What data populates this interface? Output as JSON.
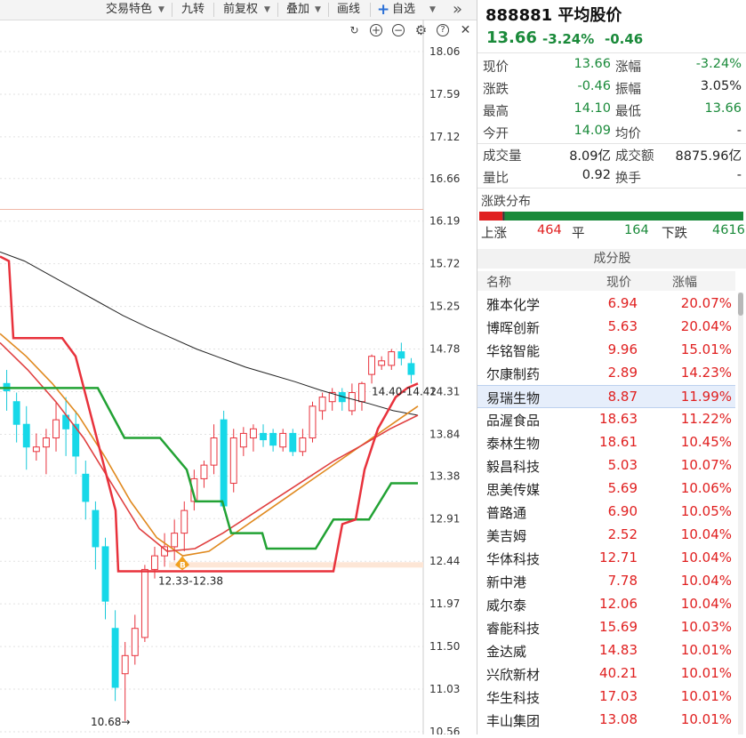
{
  "toolbar": {
    "items": [
      "交易特色",
      "九转",
      "前复权",
      "叠加",
      "画线",
      "自选"
    ],
    "more": "»"
  },
  "chart": {
    "price_axis": [
      "18.06",
      "17.59",
      "17.12",
      "16.66",
      "16.19",
      "15.72",
      "15.25",
      "14.78",
      "14.31",
      "13.84",
      "13.38",
      "12.91",
      "12.44",
      "11.97",
      "11.50",
      "11.03",
      "10.56"
    ],
    "annotation_low": "10.68→",
    "annotation_range": "12.33-12.38",
    "annotation_recent": "14.40-14.42",
    "buy_mark": "B"
  },
  "chart_data": {
    "type": "candlestick",
    "ylim": [
      10.56,
      18.06
    ],
    "candles": [
      {
        "o": 14.4,
        "c": 14.32,
        "h": 14.55,
        "l": 14.1
      },
      {
        "o": 14.2,
        "c": 13.95,
        "h": 14.3,
        "l": 13.75
      },
      {
        "o": 13.95,
        "c": 13.7,
        "h": 14.15,
        "l": 13.45
      },
      {
        "o": 13.65,
        "c": 13.7,
        "h": 13.85,
        "l": 13.55
      },
      {
        "o": 13.7,
        "c": 13.8,
        "h": 13.9,
        "l": 13.4
      },
      {
        "o": 13.8,
        "c": 14.0,
        "h": 14.2,
        "l": 13.65
      },
      {
        "o": 14.05,
        "c": 13.9,
        "h": 14.25,
        "l": 13.6
      },
      {
        "o": 13.95,
        "c": 13.6,
        "h": 14.1,
        "l": 13.4
      },
      {
        "o": 13.4,
        "c": 13.1,
        "h": 13.55,
        "l": 12.9
      },
      {
        "o": 13.0,
        "c": 12.6,
        "h": 13.1,
        "l": 12.35
      },
      {
        "o": 12.6,
        "c": 12.0,
        "h": 12.7,
        "l": 11.8
      },
      {
        "o": 11.7,
        "c": 11.05,
        "h": 11.9,
        "l": 10.9
      },
      {
        "o": 11.2,
        "c": 11.4,
        "h": 11.55,
        "l": 10.68
      },
      {
        "o": 11.4,
        "c": 11.7,
        "h": 11.85,
        "l": 11.3
      },
      {
        "o": 11.6,
        "c": 12.35,
        "h": 12.4,
        "l": 11.55
      },
      {
        "o": 12.35,
        "c": 12.5,
        "h": 12.6,
        "l": 12.25
      },
      {
        "o": 12.5,
        "c": 12.6,
        "h": 12.75,
        "l": 12.38
      },
      {
        "o": 12.6,
        "c": 12.75,
        "h": 12.9,
        "l": 12.45
      },
      {
        "o": 12.75,
        "c": 13.0,
        "h": 13.1,
        "l": 12.55
      },
      {
        "o": 13.1,
        "c": 13.35,
        "h": 13.45,
        "l": 13.0
      },
      {
        "o": 13.35,
        "c": 13.5,
        "h": 13.55,
        "l": 13.25
      },
      {
        "o": 13.5,
        "c": 13.8,
        "h": 13.95,
        "l": 13.4
      },
      {
        "o": 14.0,
        "c": 13.05,
        "h": 14.1,
        "l": 13.0
      },
      {
        "o": 13.3,
        "c": 13.8,
        "h": 13.9,
        "l": 13.2
      },
      {
        "o": 13.7,
        "c": 13.85,
        "h": 13.92,
        "l": 13.6
      },
      {
        "o": 13.8,
        "c": 13.9,
        "h": 13.95,
        "l": 13.65
      },
      {
        "o": 13.85,
        "c": 13.78,
        "h": 13.95,
        "l": 13.7
      },
      {
        "o": 13.85,
        "c": 13.72,
        "h": 13.9,
        "l": 13.65
      },
      {
        "o": 13.7,
        "c": 13.85,
        "h": 13.9,
        "l": 13.65
      },
      {
        "o": 13.85,
        "c": 13.65,
        "h": 13.9,
        "l": 13.6
      },
      {
        "o": 13.65,
        "c": 13.8,
        "h": 13.9,
        "l": 13.6
      },
      {
        "o": 13.8,
        "c": 14.15,
        "h": 14.2,
        "l": 13.75
      },
      {
        "o": 14.1,
        "c": 14.25,
        "h": 14.3,
        "l": 14.0
      },
      {
        "o": 14.2,
        "c": 14.3,
        "h": 14.35,
        "l": 14.1
      },
      {
        "o": 14.3,
        "c": 14.2,
        "h": 14.35,
        "l": 14.1
      },
      {
        "o": 14.1,
        "c": 14.3,
        "h": 14.4,
        "l": 14.05
      },
      {
        "o": 14.2,
        "c": 14.4,
        "h": 14.42,
        "l": 14.1
      },
      {
        "o": 14.5,
        "c": 14.7,
        "h": 14.72,
        "l": 14.4
      },
      {
        "o": 14.6,
        "c": 14.65,
        "h": 14.7,
        "l": 14.55
      },
      {
        "o": 14.6,
        "c": 14.75,
        "h": 14.78,
        "l": 14.55
      },
      {
        "o": 14.75,
        "c": 14.68,
        "h": 14.85,
        "l": 14.6
      },
      {
        "o": 14.62,
        "c": 14.5,
        "h": 14.68,
        "l": 14.4
      }
    ],
    "ma_black": [
      15.85,
      15.75,
      15.6,
      15.45,
      15.3,
      15.15,
      15.02,
      14.9,
      14.78,
      14.68,
      14.58,
      14.5,
      14.42,
      14.33,
      14.25,
      14.18,
      14.1,
      14.05
    ],
    "ma_orange": [
      14.95,
      14.7,
      14.4,
      14.05,
      13.6,
      13.1,
      12.7,
      12.5,
      12.55,
      12.75,
      12.95,
      13.15,
      13.35,
      13.55,
      13.75,
      13.95,
      14.15
    ],
    "ma_red_thin": [
      14.85,
      14.55,
      14.2,
      13.8,
      13.3,
      12.8,
      12.55,
      12.58,
      12.75,
      12.95,
      13.15,
      13.35,
      13.55,
      13.72,
      13.9,
      14.05
    ]
  },
  "header": {
    "code_name": "888881 平均股价",
    "price": "13.66",
    "pct": "-3.24%",
    "change": "-0.46"
  },
  "quote": [
    {
      "l1": "现价",
      "v1": "13.66",
      "c1": "#1a8a3a",
      "l2": "涨幅",
      "v2": "-3.24%",
      "c2": "#1a8a3a"
    },
    {
      "l1": "涨跌",
      "v1": "-0.46",
      "c1": "#1a8a3a",
      "l2": "振幅",
      "v2": "3.05%",
      "c2": "#222"
    },
    {
      "l1": "最高",
      "v1": "14.10",
      "c1": "#1a8a3a",
      "l2": "最低",
      "v2": "13.66",
      "c2": "#1a8a3a"
    },
    {
      "l1": "今开",
      "v1": "14.09",
      "c1": "#1a8a3a",
      "l2": "均价",
      "v2": "-",
      "c2": "#222"
    },
    {
      "l1": "成交量",
      "v1": "8.09亿",
      "c1": "#222",
      "l2": "成交额",
      "v2": "8875.96亿",
      "c2": "#222"
    },
    {
      "l1": "量比",
      "v1": "0.92",
      "c1": "#222",
      "l2": "换手",
      "v2": "-",
      "c2": "#222"
    }
  ],
  "distribution": {
    "title": "涨跌分布",
    "up_label": "上涨",
    "up": "464",
    "flat_label": "平",
    "flat": "164",
    "down_label": "下跌",
    "down": "4616",
    "colors": {
      "up": "#e02020",
      "flat": "#333333",
      "down": "#1a8a3a"
    }
  },
  "components": {
    "title": "成分股",
    "cols": {
      "name": "名称",
      "price": "现价",
      "pct": "涨幅"
    },
    "rows": [
      {
        "name": "雅本化学",
        "price": "6.94",
        "pct": "20.07%"
      },
      {
        "name": "博晖创新",
        "price": "5.63",
        "pct": "20.04%"
      },
      {
        "name": "华铭智能",
        "price": "9.96",
        "pct": "15.01%"
      },
      {
        "name": "尔康制药",
        "price": "2.89",
        "pct": "14.23%"
      },
      {
        "name": "易瑞生物",
        "price": "8.87",
        "pct": "11.99%"
      },
      {
        "name": "品渥食品",
        "price": "18.63",
        "pct": "11.22%"
      },
      {
        "name": "泰林生物",
        "price": "18.61",
        "pct": "10.45%"
      },
      {
        "name": "毅昌科技",
        "price": "5.03",
        "pct": "10.07%"
      },
      {
        "name": "思美传媒",
        "price": "5.69",
        "pct": "10.06%"
      },
      {
        "name": "普路通",
        "price": "6.90",
        "pct": "10.05%"
      },
      {
        "name": "美吉姆",
        "price": "2.52",
        "pct": "10.04%"
      },
      {
        "name": "华体科技",
        "price": "12.71",
        "pct": "10.04%"
      },
      {
        "name": "新中港",
        "price": "7.78",
        "pct": "10.04%"
      },
      {
        "name": "威尔泰",
        "price": "12.06",
        "pct": "10.04%"
      },
      {
        "name": "睿能科技",
        "price": "15.69",
        "pct": "10.03%"
      },
      {
        "name": "金达威",
        "price": "14.83",
        "pct": "10.01%"
      },
      {
        "name": "兴欣新材",
        "price": "40.21",
        "pct": "10.01%"
      },
      {
        "name": "华生科技",
        "price": "17.03",
        "pct": "10.01%"
      },
      {
        "name": "丰山集团",
        "price": "13.08",
        "pct": "10.01%"
      }
    ]
  }
}
